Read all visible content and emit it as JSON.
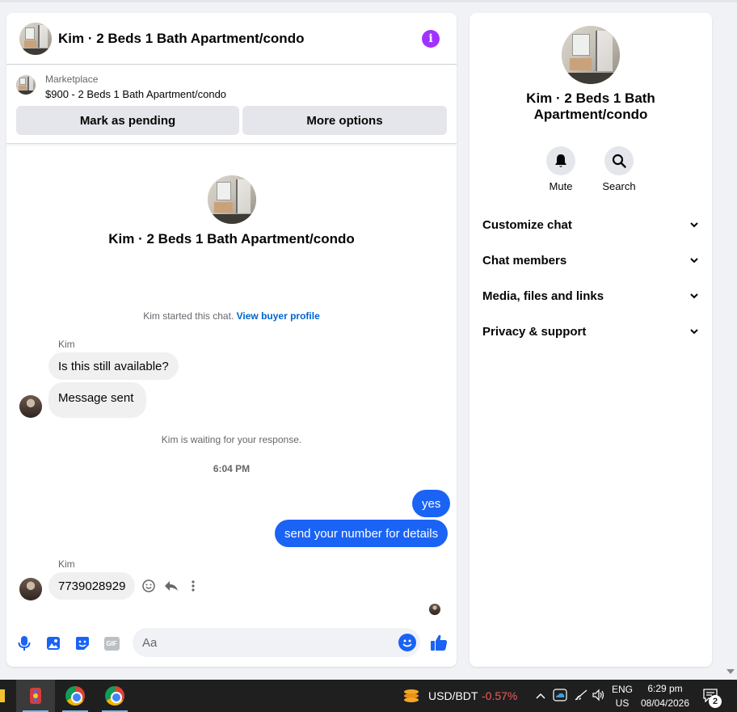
{
  "chat": {
    "header_title": "Kim · 2 Beds 1 Bath Apartment/condo",
    "info_icon": "i",
    "listing": {
      "source": "Marketplace",
      "title": "$900 - 2 Beds 1 Bath Apartment/condo",
      "pending_button": "Mark as pending",
      "more_button": "More options"
    },
    "profile_name": "Kim · 2 Beds 1 Bath Apartment/condo",
    "started_text": "Kim started this chat.",
    "buyer_profile_link": "View buyer profile",
    "messages": [
      {
        "sender": "Kim",
        "text": "Is this still available?",
        "direction": "in"
      },
      {
        "text": "Message sent",
        "direction": "in"
      }
    ],
    "waiting_text": "Kim is waiting for your response.",
    "timestamp": "6:04 PM",
    "outgoing": [
      {
        "text": "yes",
        "direction": "out"
      },
      {
        "text": "send your number for details",
        "direction": "out"
      }
    ],
    "last_message": {
      "sender": "Kim",
      "text": "7739028929",
      "direction": "in"
    },
    "composer_placeholder": "Aa",
    "gif_label": "GIF"
  },
  "info_panel": {
    "name": "Kim · 2 Beds 1 Bath Apartment/condo",
    "actions": [
      {
        "label": "Mute",
        "icon": "bell-icon"
      },
      {
        "label": "Search",
        "icon": "search-icon"
      }
    ],
    "sections": [
      "Customize chat",
      "Chat members",
      "Media, files and links",
      "Privacy & support"
    ]
  },
  "taskbar": {
    "currency": "USD/BDT",
    "currency_change": "-0.57%",
    "language": "ENG",
    "region": "US",
    "time": "6:29 pm",
    "date": "08/04/2026",
    "notifications": "2"
  },
  "colors": {
    "accent": "#1a63f5",
    "info": "#a033ff",
    "link": "#0064d1",
    "negative": "#f45b5b"
  }
}
